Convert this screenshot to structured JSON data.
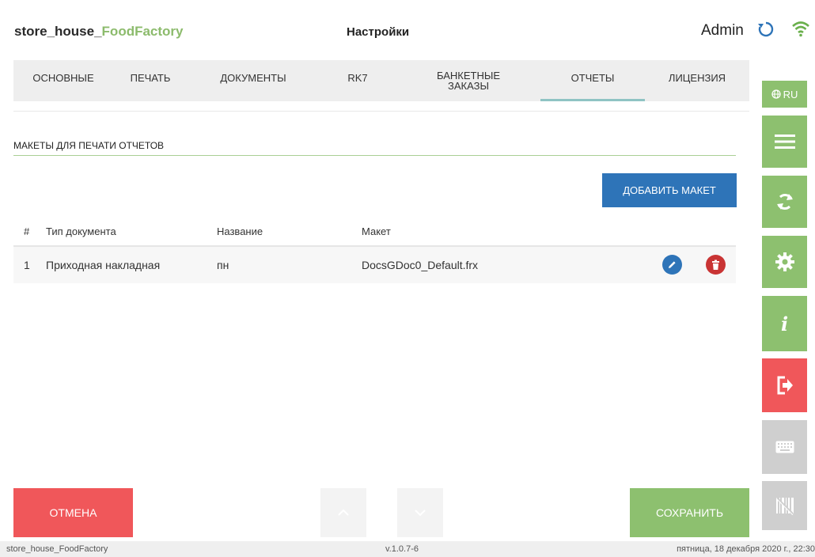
{
  "header": {
    "app_name_main": "store_house_",
    "app_name_accent": "FoodFactory",
    "page_title": "Настройки",
    "user": "Admin"
  },
  "tabs": [
    {
      "label": "ОСНОВНЫЕ",
      "active": false
    },
    {
      "label": "ПЕЧАТЬ",
      "active": false
    },
    {
      "label": "ДОКУМЕНТЫ",
      "active": false
    },
    {
      "label": "RK7",
      "active": false
    },
    {
      "label": "БАНКЕТНЫЕ ЗАКАЗЫ",
      "active": false
    },
    {
      "label": "ОТЧЕТЫ",
      "active": true
    },
    {
      "label": "ЛИЦЕНЗИЯ",
      "active": false
    }
  ],
  "section": {
    "title": "МАКЕТЫ ДЛЯ ПЕЧАТИ ОТЧЕТОВ",
    "add_button": "ДОБАВИТЬ МАКЕТ"
  },
  "table": {
    "headers": {
      "num": "#",
      "type": "Тип документа",
      "name": "Название",
      "layout": "Макет"
    },
    "rows": [
      {
        "num": "1",
        "type": "Приходная накладная",
        "name": "пн",
        "layout": "DocsGDoc0_Default.frx"
      }
    ]
  },
  "buttons": {
    "cancel": "ОТМЕНА",
    "save": "СОХРАНИТЬ"
  },
  "sidebar": {
    "lang": "RU",
    "info_glyph": "i"
  },
  "footer": {
    "left": "store_house_FoodFactory",
    "version": "v.1.0.7-6",
    "datetime": "пятница, 18 декабря 2020 г., 22:30"
  },
  "colors": {
    "accent_green": "#8dc06f",
    "primary_blue": "#2e74b8",
    "danger_red": "#f0575a",
    "delete_red": "#c93434",
    "disabled_gray": "#cfcfcf"
  }
}
